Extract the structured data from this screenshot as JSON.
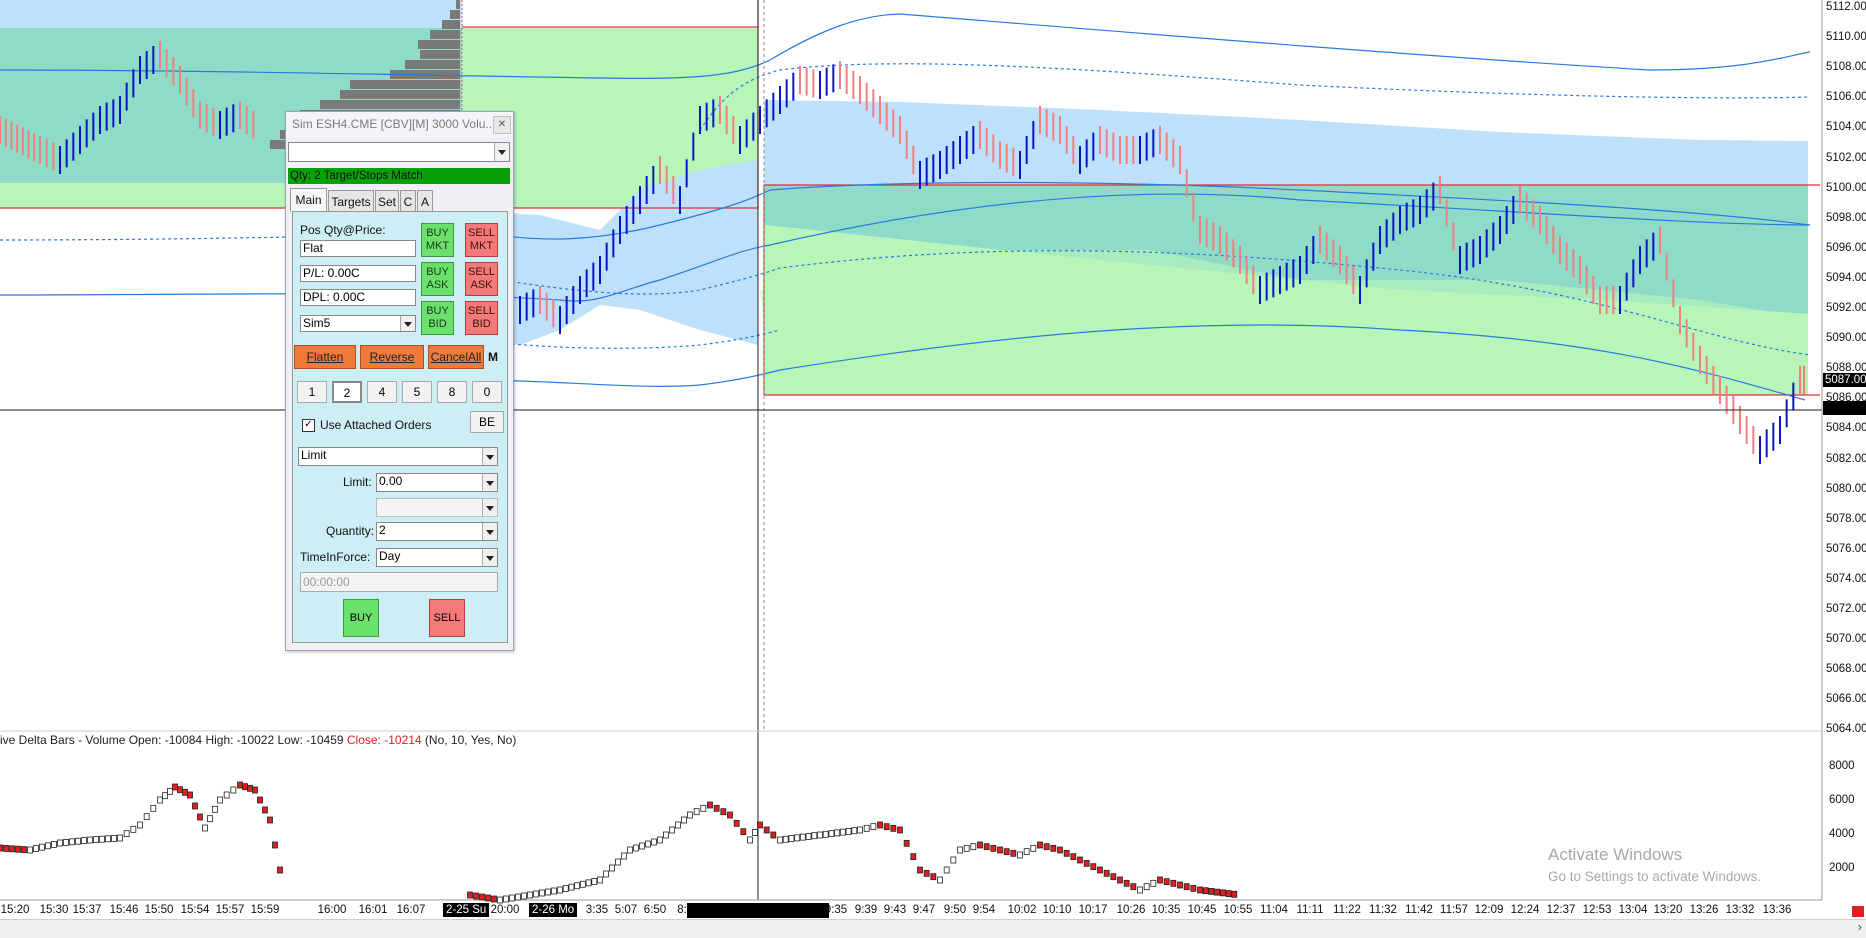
{
  "price_axis": [
    "5112.00",
    "5110.00",
    "5108.00",
    "5106.00",
    "5104.00",
    "5102.00",
    "5100.00",
    "5098.00",
    "5096.00",
    "5094.00",
    "5092.00",
    "5090.00",
    "5088.00",
    "5086.00",
    "5084.00",
    "5082.00",
    "5080.00",
    "5078.00",
    "5076.00",
    "5074.00",
    "5072.00",
    "5070.00",
    "5068.00",
    "5066.00",
    "5064.00"
  ],
  "last_price_tag": "5087.00",
  "indicator_axis": [
    "8000",
    "6000",
    "4000",
    "2000"
  ],
  "indicator_title": {
    "prefix": "ive Delta Bars - Volume  Open: -10084  High: -10022  Low: -10459  ",
    "close": "Close: -10214",
    "suffix": "  (No, 10, Yes, No)"
  },
  "time_labels": [
    "15:20",
    "15:30",
    "15:37",
    "15:46",
    "15:50",
    "15:54",
    "15:57",
    "15:59",
    "16:00",
    "16:01",
    "16:07",
    "20:00",
    "3:35",
    "5:07",
    "6:50",
    "8:",
    "9:35",
    "9:39",
    "9:43",
    "9:47",
    "9:50",
    "9:54",
    "10:02",
    "10:10",
    "10:17",
    "10:26",
    "10:35",
    "10:45",
    "10:55",
    "11:04",
    "11:11",
    "11:22",
    "11:32",
    "11:42",
    "11:57",
    "12:09",
    "12:24",
    "12:37",
    "12:53",
    "13:04",
    "13:20",
    "13:26",
    "13:32",
    "13:36"
  ],
  "session_labels": [
    "2-25 Su",
    "2-26 Mo"
  ],
  "watermark": {
    "title": "Activate Windows",
    "subtitle": "Go to Settings to activate Windows."
  },
  "chart_trader": {
    "title": "Sim ESH4.CME [CBV][M]  3000 Volu...",
    "close_glyph": "✕",
    "account_combo": "",
    "status": "Qty: 2 Target/Stops Match",
    "tabs": [
      "Main",
      "Targets",
      "Set",
      "C",
      "A"
    ],
    "pos_label": "Pos Qty@Price:",
    "pos_value": "Flat",
    "pl_value": "P/L: 0.00C",
    "dpl_value": "DPL: 0.00C",
    "account": "Sim5",
    "buy_mkt": [
      "BUY",
      "MKT"
    ],
    "sell_mkt": [
      "SELL",
      "MKT"
    ],
    "buy_ask": [
      "BUY",
      "ASK"
    ],
    "sell_ask": [
      "SELL",
      "ASK"
    ],
    "buy_bid": [
      "BUY",
      "BID"
    ],
    "sell_bid": [
      "SELL",
      "BID"
    ],
    "flatten": "Flatten",
    "reverse": "Reverse",
    "cancel_all": "CancelAll",
    "m_btn": "M",
    "qty_buttons": [
      "1",
      "2",
      "4",
      "5",
      "8",
      "0"
    ],
    "use_attached": "Use Attached Orders",
    "use_attached_checked": true,
    "be_btn": "BE",
    "order_type": "Limit",
    "limit_label": "Limit:",
    "limit_value": "0.00",
    "quantity_label": "Quantity:",
    "quantity_value": "2",
    "tif_label": "TimeInForce:",
    "tif_value": "Day",
    "time_value": "00:00:00",
    "buy_btn": "BUY",
    "sell_btn": "SELL"
  },
  "colors": {
    "up_bar": "#0a14c8",
    "down_bar": "#f08080",
    "value_area": "#8edcc8",
    "green_zone": "#b8f5b8",
    "blue_band": "#bfe0fa",
    "trader_buy": "#6be06b",
    "trader_sell": "#f47a7a",
    "orange": "#f07a3a"
  }
}
